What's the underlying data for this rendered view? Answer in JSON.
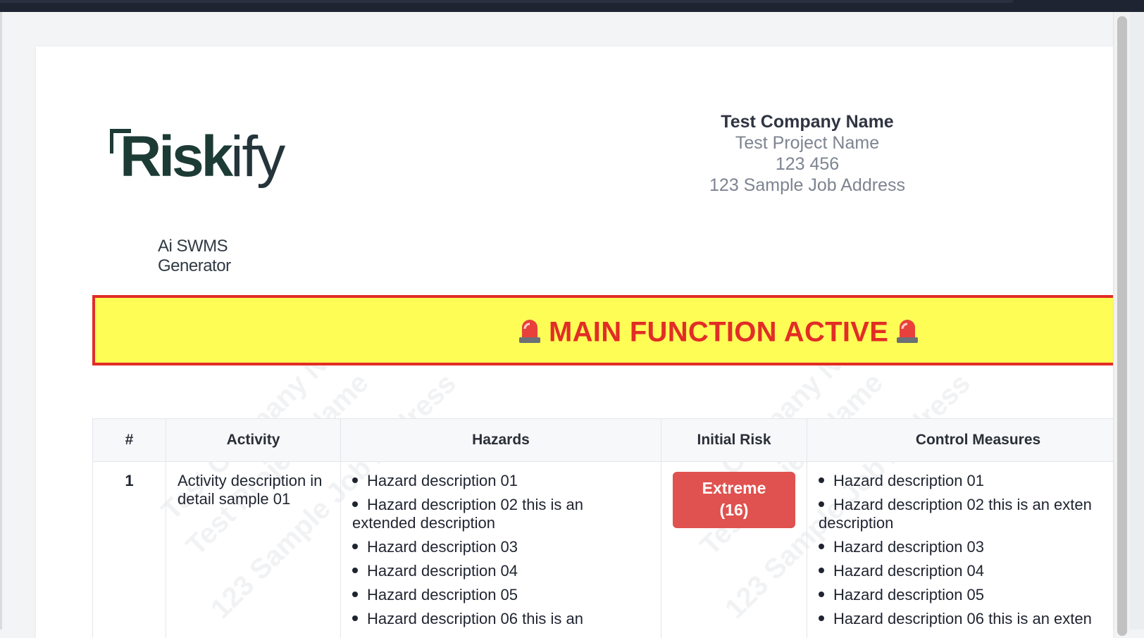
{
  "logo": {
    "brand": "Riskify",
    "brand_main": "Risk",
    "brand_tail": "ify",
    "tagline": "Ai SWMS Generator",
    "color": "#1d3b35"
  },
  "company": {
    "name": "Test Company Name",
    "project": "Test Project Name",
    "number": "123 456",
    "address": "123 Sample Job Address"
  },
  "banner": {
    "text": "MAIN FUNCTION ACTIVE",
    "icon": "police-light-icon",
    "background": "#fdfd56",
    "color": "#e22d26"
  },
  "watermark": {
    "lines": [
      "Test Company Name",
      "Test Project Name",
      "123 Sample Job Address"
    ]
  },
  "table": {
    "headers": [
      "#",
      "Activity",
      "Hazards",
      "Initial Risk",
      "Control Measures"
    ],
    "rows": [
      {
        "num": "1",
        "activity": "Activity description in detail sample 01",
        "hazards": [
          "Hazard description 01",
          "Hazard description 02 this is an extended description",
          "Hazard description 03",
          "Hazard description 04",
          "Hazard description 05",
          "Hazard description 06 this is an"
        ],
        "risk": {
          "level": "Extreme",
          "score": "(16)",
          "color": "#e0524f"
        },
        "controls": [
          "Hazard description 01",
          "Hazard description 02 this is an exten",
          "description",
          "Hazard description 03",
          "Hazard description 04",
          "Hazard description 05",
          "Hazard description 06 this is an exten"
        ]
      }
    ]
  }
}
